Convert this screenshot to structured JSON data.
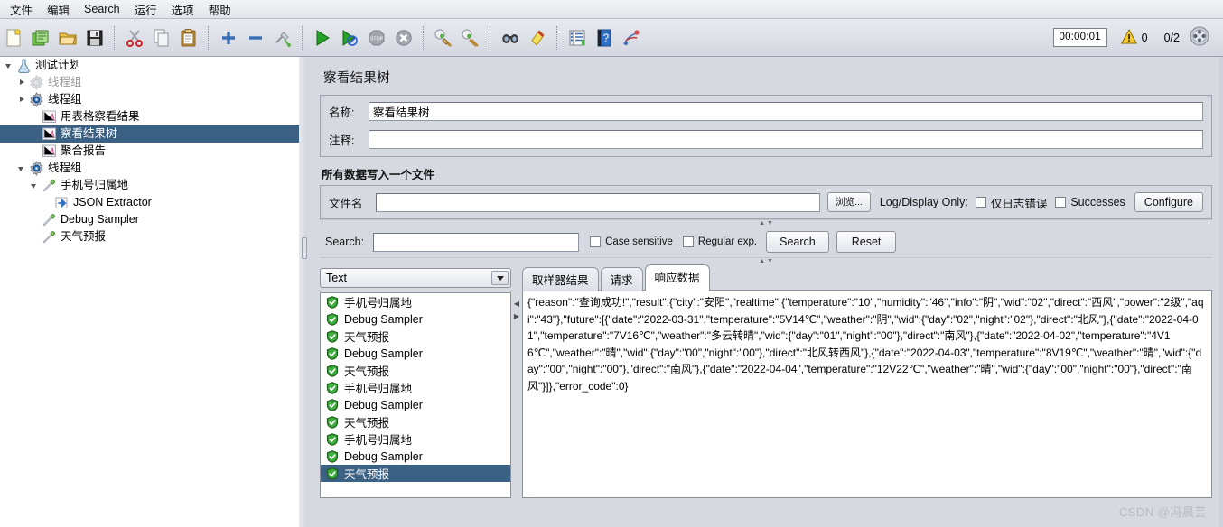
{
  "menu": {
    "items": [
      {
        "label": "文件"
      },
      {
        "label": "编辑"
      },
      {
        "label": "Search",
        "mnemonic": "S"
      },
      {
        "label": "运行"
      },
      {
        "label": "选项"
      },
      {
        "label": "帮助"
      }
    ]
  },
  "toolbar": {
    "icons": [
      {
        "name": "new-icon",
        "title": "新建"
      },
      {
        "name": "templates-icon",
        "title": "模板"
      },
      {
        "name": "open-icon",
        "title": "打开"
      },
      {
        "name": "save-icon",
        "title": "保存"
      },
      {
        "name": "cut-icon",
        "title": "剪切"
      },
      {
        "name": "copy-icon",
        "title": "复制"
      },
      {
        "name": "paste-icon",
        "title": "粘贴"
      },
      {
        "name": "expand-all-icon",
        "title": "展开全部"
      },
      {
        "name": "collapse-all-icon",
        "title": "折叠全部"
      },
      {
        "name": "toggle-icon",
        "title": "启用/禁用"
      },
      {
        "name": "start-icon",
        "title": "启动"
      },
      {
        "name": "start-no-pause-icon",
        "title": "无间隔启动"
      },
      {
        "name": "stop-icon",
        "title": "停止"
      },
      {
        "name": "shutdown-icon",
        "title": "关闭"
      },
      {
        "name": "clear-icon",
        "title": "清除"
      },
      {
        "name": "clear-all-icon",
        "title": "清除全部"
      },
      {
        "name": "search-icon",
        "title": "查找"
      },
      {
        "name": "search-reset-icon",
        "title": "重置查找"
      },
      {
        "name": "function-helper-icon",
        "title": "函数助手"
      },
      {
        "name": "help-icon",
        "title": "帮助"
      },
      {
        "name": "undo-redo-icon",
        "title": "撤销"
      }
    ],
    "elapsed_time": "00:00:01",
    "warning_count": "0",
    "threads_ratio": "0/2",
    "warning_icon": "warning-triangle-icon",
    "thread_status_icon": "thread-status-icon"
  },
  "tree": {
    "nodes": [
      {
        "label": "测试计划",
        "depth": 0,
        "twisty": "open",
        "icon": "test-plan-icon",
        "selected": false,
        "dim": false
      },
      {
        "label": "线程组",
        "depth": 1,
        "twisty": "closed",
        "icon": "thread-group-grey-icon",
        "selected": false,
        "dim": true
      },
      {
        "label": "线程组",
        "depth": 1,
        "twisty": "closed",
        "icon": "thread-group-icon",
        "selected": false,
        "dim": false
      },
      {
        "label": "用表格察看结果",
        "depth": 2,
        "twisty": "none",
        "icon": "listener-icon",
        "selected": false,
        "dim": false
      },
      {
        "label": "察看结果树",
        "depth": 2,
        "twisty": "none",
        "icon": "listener-icon",
        "selected": true,
        "dim": false
      },
      {
        "label": "聚合报告",
        "depth": 2,
        "twisty": "none",
        "icon": "listener-icon",
        "selected": false,
        "dim": false
      },
      {
        "label": "线程组",
        "depth": 1,
        "twisty": "open",
        "icon": "thread-group-icon",
        "selected": false,
        "dim": false
      },
      {
        "label": "手机号归属地",
        "depth": 2,
        "twisty": "open",
        "icon": "sampler-icon",
        "selected": false,
        "dim": false
      },
      {
        "label": "JSON Extractor",
        "depth": 3,
        "twisty": "none",
        "icon": "postprocessor-icon",
        "selected": false,
        "dim": false
      },
      {
        "label": "Debug Sampler",
        "depth": 2,
        "twisty": "none",
        "icon": "sampler-icon",
        "selected": false,
        "dim": false
      },
      {
        "label": "天气预报",
        "depth": 2,
        "twisty": "none",
        "icon": "sampler-icon",
        "selected": false,
        "dim": false
      }
    ]
  },
  "panel": {
    "title": "察看结果树",
    "name_label": "名称:",
    "name_value": "察看结果树",
    "comment_label": "注释:",
    "comment_value": "",
    "file_group_title": "所有数据写入一个文件",
    "filename_label": "文件名",
    "filename_value": "",
    "browse_button": "浏览...",
    "log_display_label": "Log/Display Only:",
    "errors_only_label": "仅日志错误",
    "errors_only_checked": false,
    "successes_label": "Successes",
    "successes_checked": false,
    "configure_button": "Configure"
  },
  "search": {
    "label": "Search:",
    "value": "",
    "case_sensitive_label": "Case sensitive",
    "case_sensitive_checked": false,
    "regex_label": "Regular exp.",
    "regex_checked": false,
    "search_button": "Search",
    "reset_button": "Reset"
  },
  "results": {
    "render_select": "Text",
    "render_options": [
      "Text"
    ],
    "items": [
      {
        "label": "手机号归属地",
        "status": "success",
        "selected": false
      },
      {
        "label": "Debug Sampler",
        "status": "success",
        "selected": false
      },
      {
        "label": "天气预报",
        "status": "success",
        "selected": false
      },
      {
        "label": "Debug Sampler",
        "status": "success",
        "selected": false
      },
      {
        "label": "天气预报",
        "status": "success",
        "selected": false
      },
      {
        "label": "手机号归属地",
        "status": "success",
        "selected": false
      },
      {
        "label": "Debug Sampler",
        "status": "success",
        "selected": false
      },
      {
        "label": "天气预报",
        "status": "success",
        "selected": false
      },
      {
        "label": "手机号归属地",
        "status": "success",
        "selected": false
      },
      {
        "label": "Debug Sampler",
        "status": "success",
        "selected": false
      },
      {
        "label": "天气预报",
        "status": "success",
        "selected": true
      }
    ],
    "tabs": [
      {
        "label": "取样器结果",
        "active": false
      },
      {
        "label": "请求",
        "active": false
      },
      {
        "label": "响应数据",
        "active": true
      }
    ],
    "response_body": "{\"reason\":\"查询成功!\",\"result\":{\"city\":\"安阳\",\"realtime\":{\"temperature\":\"10\",\"humidity\":\"46\",\"info\":\"阴\",\"wid\":\"02\",\"direct\":\"西风\",\"power\":\"2级\",\"aqi\":\"43\"},\"future\":[{\"date\":\"2022-03-31\",\"temperature\":\"5V14℃\",\"weather\":\"阴\",\"wid\":{\"day\":\"02\",\"night\":\"02\"},\"direct\":\"北风\"},{\"date\":\"2022-04-01\",\"temperature\":\"7V16℃\",\"weather\":\"多云转晴\",\"wid\":{\"day\":\"01\",\"night\":\"00\"},\"direct\":\"南风\"},{\"date\":\"2022-04-02\",\"temperature\":\"4V16℃\",\"weather\":\"晴\",\"wid\":{\"day\":\"00\",\"night\":\"00\"},\"direct\":\"北风转西风\"},{\"date\":\"2022-04-03\",\"temperature\":\"8V19℃\",\"weather\":\"晴\",\"wid\":{\"day\":\"00\",\"night\":\"00\"},\"direct\":\"南风\"},{\"date\":\"2022-04-04\",\"temperature\":\"12V22℃\",\"weather\":\"晴\",\"wid\":{\"day\":\"00\",\"night\":\"00\"},\"direct\":\"南风\"}]},\"error_code\":0}"
  },
  "watermark": "CSDN @冯晨芸",
  "colors": {
    "selection": "#3a6084",
    "panel_bg": "#d6d9e0",
    "success_green": "#2f9e2f",
    "warning_yellow": "#f2c12e",
    "tree_text": "#1a1a1a"
  }
}
